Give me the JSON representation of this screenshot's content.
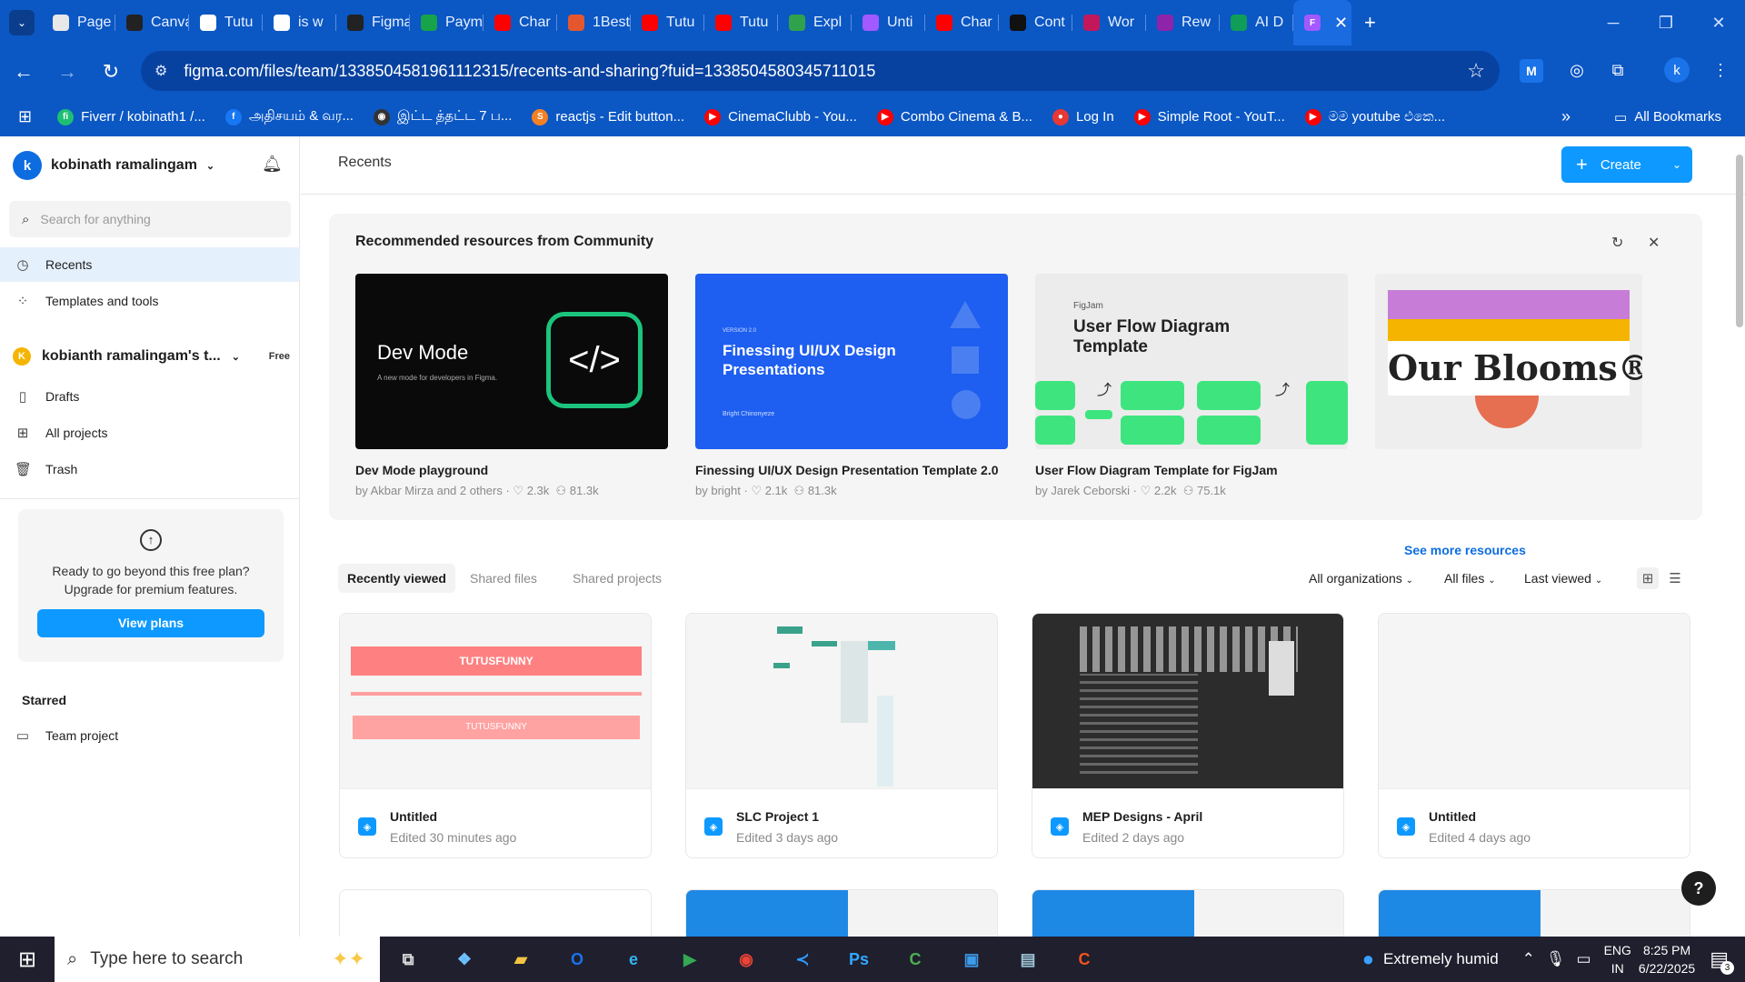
{
  "browser": {
    "tabs": [
      {
        "label": "Page",
        "color": "#e8e8e8",
        "icon": "page-icon"
      },
      {
        "label": "Canva",
        "color": "#222",
        "icon": "ai-icon"
      },
      {
        "label": "Tutu",
        "color": "#fff",
        "icon": "doc-icon"
      },
      {
        "label": "is w",
        "color": "#fff",
        "icon": "google-icon"
      },
      {
        "label": "Figma",
        "color": "#222",
        "icon": "ai-icon"
      },
      {
        "label": "Payment",
        "color": "#17a34a",
        "icon": "check-icon"
      },
      {
        "label": "Char",
        "color": "#ff0000",
        "icon": "youtube-icon"
      },
      {
        "label": "1Best",
        "color": "#e4572e",
        "icon": "chart-icon"
      },
      {
        "label": "Tutu",
        "color": "#ff0000",
        "icon": "youtube-icon"
      },
      {
        "label": "Tutu",
        "color": "#ff0000",
        "icon": "youtube-icon"
      },
      {
        "label": "Expl",
        "color": "#31a24c",
        "icon": "trend-icon"
      },
      {
        "label": "Unti",
        "color": "#a259ff",
        "icon": "figma-icon"
      },
      {
        "label": "Char",
        "color": "#ff0000",
        "icon": "youtube-icon"
      },
      {
        "label": "Cont",
        "color": "#111",
        "icon": "st-icon"
      },
      {
        "label": "Wor",
        "color": "#c2185b",
        "icon": "word-icon"
      },
      {
        "label": "Rew",
        "color": "#8e24aa",
        "icon": "rew-icon"
      },
      {
        "label": "AI D",
        "color": "#0f9d58",
        "icon": "sheets-icon"
      }
    ],
    "active_tab_close": "✕",
    "url": "figma.com/files/team/1338504581961112315/recents-and-sharing?fuid=1338504580345711015",
    "bookmarks": [
      {
        "label": "Fiverr / kobinath1 /...",
        "color": "#1dbf73",
        "text": "fi"
      },
      {
        "label": "அதிசயம் & வர...",
        "color": "#1877f2",
        "text": "f"
      },
      {
        "label": "இட்ட த்தட்ட 7 ப...",
        "color": "#333",
        "text": "◉"
      },
      {
        "label": "reactjs - Edit button...",
        "color": "#f48024",
        "text": "S"
      },
      {
        "label": "CinemaClubb - You...",
        "color": "#ff0000",
        "text": "▶"
      },
      {
        "label": "Combo Cinema & B...",
        "color": "#ff0000",
        "text": "▶"
      },
      {
        "label": "Log In",
        "color": "#e53935",
        "text": "●"
      },
      {
        "label": "Simple Root - YouT...",
        "color": "#ff0000",
        "text": "▶"
      },
      {
        "label": "මම youtube එකෙ...",
        "color": "#ff0000",
        "text": "▶"
      }
    ],
    "all_bookmarks": "All Bookmarks",
    "profile_initial": "k"
  },
  "sidebar": {
    "user_name": "kobinath ramalingam",
    "user_initial": "k",
    "search_placeholder": "Search for anything",
    "nav": [
      {
        "label": "Recents",
        "icon": "clock-icon"
      },
      {
        "label": "Templates and tools",
        "icon": "templates-icon"
      }
    ],
    "team_name": "kobianth ramalingam's t...",
    "team_initial": "K",
    "team_plan": "Free",
    "team_nav": [
      {
        "label": "Drafts",
        "icon": "file-icon"
      },
      {
        "label": "All projects",
        "icon": "grid-icon"
      },
      {
        "label": "Trash",
        "icon": "trash-icon"
      }
    ],
    "upgrade_line1": "Ready to go beyond this free plan?",
    "upgrade_line2": "Upgrade for premium features.",
    "upgrade_button": "View plans",
    "starred_heading": "Starred",
    "starred_item": "Team project"
  },
  "main": {
    "title": "Recents",
    "create_label": "Create",
    "recommended": {
      "heading": "Recommended resources from Community",
      "see_more": "See more resources",
      "cards": [
        {
          "title": "Dev Mode playground",
          "author": "by Akbar Mirza and 2 others",
          "likes": "2.3k",
          "users": "81.3k",
          "thumb_title": "Dev Mode",
          "thumb_sub": "A new mode for developers in Figma."
        },
        {
          "title": "Finessing UI/UX Design Presentation Template 2.0",
          "author": "by bright",
          "likes": "2.1k",
          "users": "81.3k",
          "thumb_version": "VERSION 2.0",
          "thumb_title": "Finessing UI/UX Design Presentations",
          "thumb_author": "Bright Chinonyeze"
        },
        {
          "title": "User Flow Diagram Template for FigJam",
          "author": "by Jarek Ceborski",
          "likes": "2.2k",
          "users": "75.1k",
          "thumb_tag": "FigJam",
          "thumb_title": "User Flow Diagram Template"
        },
        {
          "thumb_title": "Our Blooms®"
        }
      ]
    },
    "file_tabs": [
      "Recently viewed",
      "Shared files",
      "Shared projects"
    ],
    "filters": [
      "All organizations",
      "All files",
      "Last viewed"
    ],
    "files": [
      {
        "name": "Untitled",
        "edited": "Edited 30 minutes ago",
        "thumb_text": "TUTUSFUNNY"
      },
      {
        "name": "SLC Project 1",
        "edited": "Edited 3 days ago"
      },
      {
        "name": "MEP Designs - April",
        "edited": "Edited 2 days ago"
      },
      {
        "name": "Untitled",
        "edited": "Edited 4 days ago"
      }
    ],
    "help": "?"
  },
  "taskbar": {
    "search_placeholder": "Type here to search",
    "weather": "Extremely humid",
    "lang1": "ENG",
    "lang2": "IN",
    "time": "8:25 PM",
    "date": "6/22/2025",
    "notifications": "3"
  }
}
